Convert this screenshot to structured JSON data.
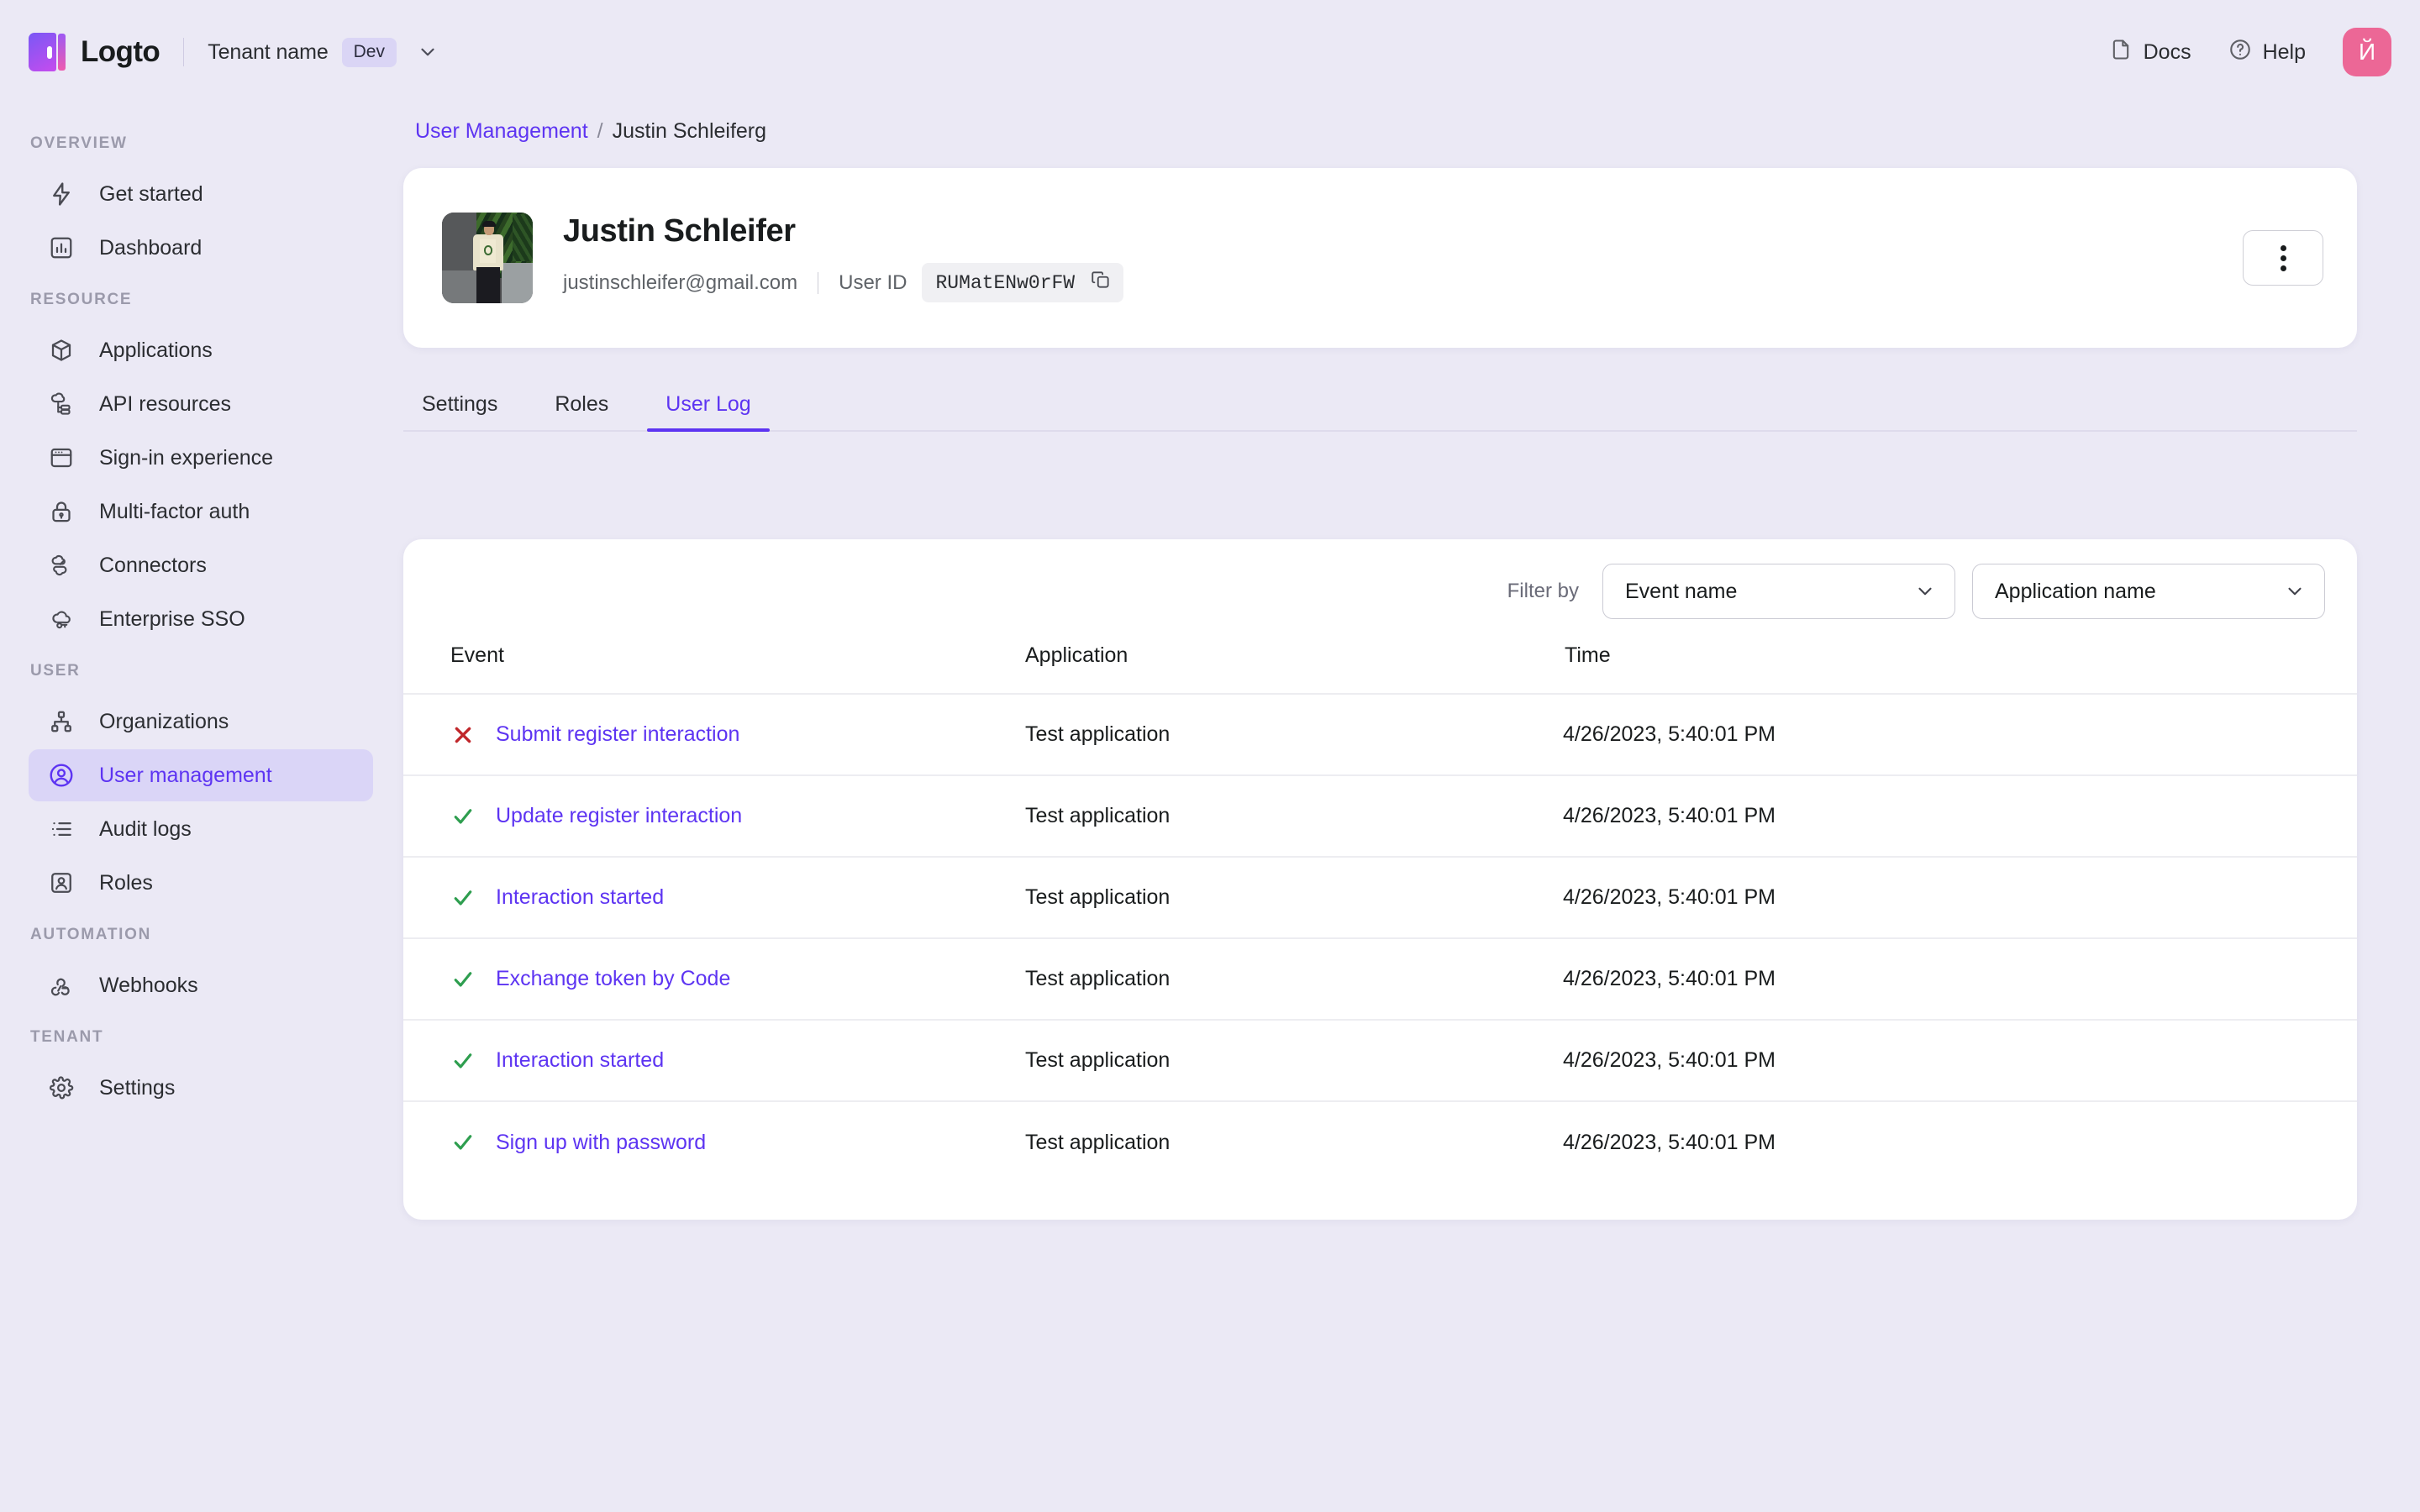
{
  "brand": {
    "name": "Logto",
    "logo_icon": "logto-logo-icon"
  },
  "topbar": {
    "tenant_name": "Tenant name",
    "tenant_badge": "Dev",
    "tenant_chevron_icon": "chevron-down-icon",
    "docs_label": "Docs",
    "docs_icon": "document-icon",
    "help_label": "Help",
    "help_icon": "question-circle-icon",
    "avatar_initial": "Й",
    "avatar_color": "#EC6796"
  },
  "sidebar": {
    "sections": [
      {
        "title": "OVERVIEW",
        "items": [
          {
            "label": "Get started",
            "icon": "lightning-icon",
            "active": false
          },
          {
            "label": "Dashboard",
            "icon": "bar-chart-icon",
            "active": false
          }
        ]
      },
      {
        "title": "RESOURCE",
        "items": [
          {
            "label": "Applications",
            "icon": "cube-icon",
            "active": false
          },
          {
            "label": "API resources",
            "icon": "api-cloud-icon",
            "active": false
          },
          {
            "label": "Sign-in experience",
            "icon": "browser-window-icon",
            "active": false
          },
          {
            "label": "Multi-factor auth",
            "icon": "lock-icon",
            "active": false
          },
          {
            "label": "Connectors",
            "icon": "connectors-cloud-icon",
            "active": false
          },
          {
            "label": "Enterprise SSO",
            "icon": "cloud-key-icon",
            "active": false
          }
        ]
      },
      {
        "title": "USER",
        "items": [
          {
            "label": "Organizations",
            "icon": "org-tree-icon",
            "active": false
          },
          {
            "label": "User management",
            "icon": "user-circle-icon",
            "active": true
          },
          {
            "label": "Audit logs",
            "icon": "list-lines-icon",
            "active": false
          },
          {
            "label": "Roles",
            "icon": "user-box-icon",
            "active": false
          }
        ]
      },
      {
        "title": "AUTOMATION",
        "items": [
          {
            "label": "Webhooks",
            "icon": "webhook-icon",
            "active": false
          }
        ]
      },
      {
        "title": "TENANT",
        "items": [
          {
            "label": "Settings",
            "icon": "gear-icon",
            "active": false
          }
        ]
      }
    ]
  },
  "breadcrumb": {
    "parent": "User Management",
    "separator": "/",
    "current": "Justin Schleiferg"
  },
  "profile": {
    "name": "Justin Schleifer",
    "email": "justinschleifer@gmail.com",
    "user_id_label": "User ID",
    "user_id_value": "RUMatENw0rFW",
    "copy_icon": "copy-icon",
    "more_icon": "kebab-menu-icon",
    "avatar_icon": "user-photo-avatar"
  },
  "tabs": [
    {
      "label": "Settings",
      "active": false
    },
    {
      "label": "Roles",
      "active": false
    },
    {
      "label": "User Log",
      "active": true
    }
  ],
  "filters": {
    "label": "Filter by",
    "event_name": "Event name",
    "application_name": "Application name",
    "caret_icon": "chevron-down-icon"
  },
  "log_table": {
    "columns": [
      "Event",
      "Application",
      "Time"
    ],
    "rows": [
      {
        "status": "error",
        "status_icon": "x-mark-icon",
        "event": "Submit register interaction",
        "application": "Test application",
        "time": "4/26/2023, 5:40:01 PM"
      },
      {
        "status": "success",
        "status_icon": "check-mark-icon",
        "event": "Update register interaction",
        "application": "Test application",
        "time": "4/26/2023, 5:40:01 PM"
      },
      {
        "status": "success",
        "status_icon": "check-mark-icon",
        "event": "Interaction started",
        "application": "Test application",
        "time": "4/26/2023, 5:40:01 PM"
      },
      {
        "status": "success",
        "status_icon": "check-mark-icon",
        "event": "Exchange token by Code",
        "application": "Test application",
        "time": "4/26/2023, 5:40:01 PM"
      },
      {
        "status": "success",
        "status_icon": "check-mark-icon",
        "event": "Interaction started",
        "application": "Test application",
        "time": "4/26/2023, 5:40:01 PM"
      },
      {
        "status": "success",
        "status_icon": "check-mark-icon",
        "event": "Sign up with password",
        "application": "Test application",
        "time": "4/26/2023, 5:40:01 PM"
      }
    ]
  },
  "colors": {
    "page_background": "#EBE9F5",
    "accent": "#5D34F2",
    "active_nav_background": "#DAD5F7",
    "success": "#2E9E4F",
    "error": "#C0262A",
    "card": "#FFFFFF"
  }
}
